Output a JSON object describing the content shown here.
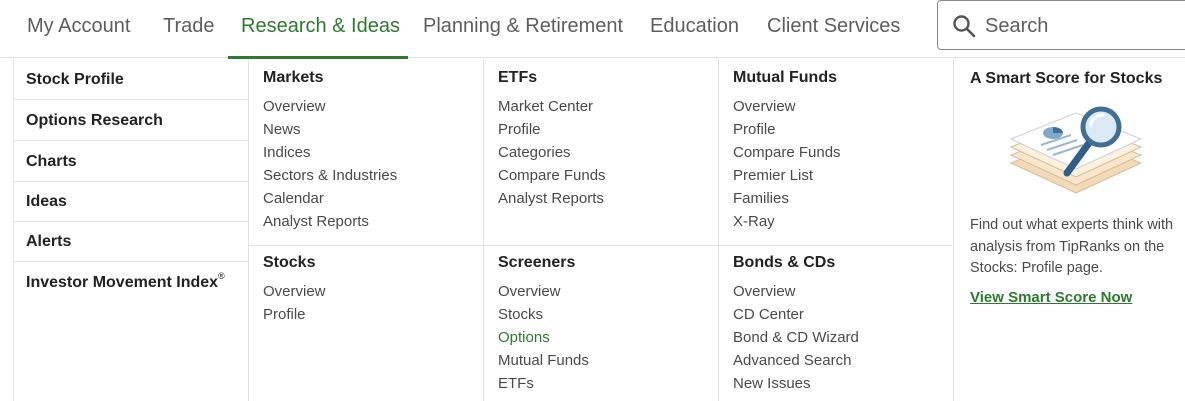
{
  "nav": {
    "items": [
      {
        "label": "My Account"
      },
      {
        "label": "Trade"
      },
      {
        "label": "Research & Ideas"
      },
      {
        "label": "Planning & Retirement"
      },
      {
        "label": "Education"
      },
      {
        "label": "Client Services"
      }
    ],
    "active_index": 2,
    "search_placeholder": "Search"
  },
  "side_menu": {
    "items": [
      {
        "label": "Stock Profile"
      },
      {
        "label": "Options Research"
      },
      {
        "label": "Charts"
      },
      {
        "label": "Ideas"
      },
      {
        "label": "Alerts"
      },
      {
        "label": "Investor Movement Index",
        "mark": "®"
      }
    ]
  },
  "columns": {
    "markets": {
      "title": "Markets",
      "links": [
        "Overview",
        "News",
        "Indices",
        "Sectors & Industries",
        "Calendar",
        "Analyst Reports"
      ]
    },
    "stocks": {
      "title": "Stocks",
      "links": [
        "Overview",
        "Profile"
      ]
    },
    "etfs": {
      "title": "ETFs",
      "links": [
        "Market Center",
        "Profile",
        "Categories",
        "Compare Funds",
        "Analyst Reports"
      ]
    },
    "screeners": {
      "title": "Screeners",
      "links": [
        "Overview",
        "Stocks",
        "Options",
        "Mutual Funds",
        "ETFs"
      ]
    },
    "mutual_funds": {
      "title": "Mutual Funds",
      "links": [
        "Overview",
        "Profile",
        "Compare Funds",
        "Premier List",
        "Families",
        "X-Ray"
      ]
    },
    "bonds_cds": {
      "title": "Bonds & CDs",
      "links": [
        "Overview",
        "CD Center",
        "Bond & CD Wizard",
        "Advanced Search",
        "New Issues"
      ]
    }
  },
  "promo": {
    "title": "A Smart Score for Stocks",
    "description": "Find out what experts think with analysis from TipRanks on the Stocks: Profile page.",
    "link_label": "View Smart Score Now",
    "image_icon": "magnifier-report-illustration"
  },
  "colors": {
    "accent_green": "#2c7a2c",
    "text": "#4a4a4a",
    "divider": "#e3e3e3"
  }
}
